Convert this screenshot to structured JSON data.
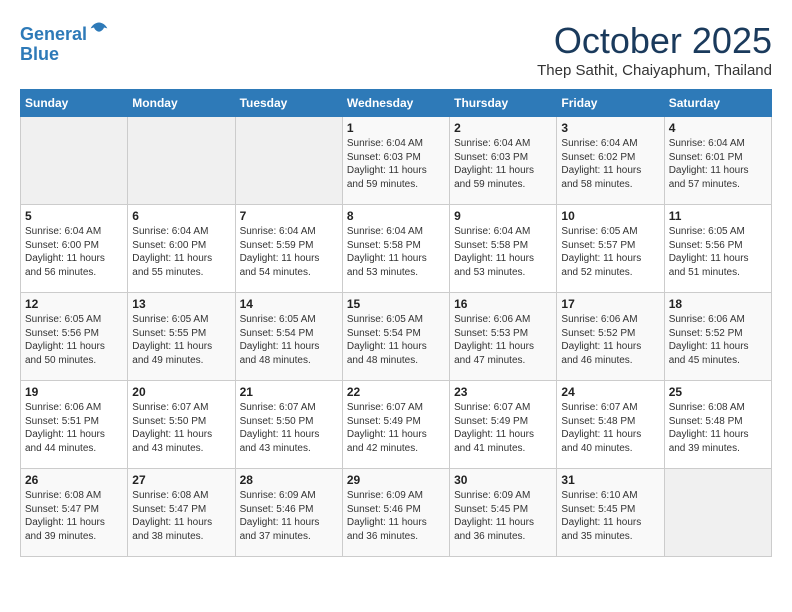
{
  "header": {
    "logo_line1": "General",
    "logo_line2": "Blue",
    "month": "October 2025",
    "location": "Thep Sathit, Chaiyaphum, Thailand"
  },
  "days_of_week": [
    "Sunday",
    "Monday",
    "Tuesday",
    "Wednesday",
    "Thursday",
    "Friday",
    "Saturday"
  ],
  "weeks": [
    [
      {
        "day": "",
        "info": ""
      },
      {
        "day": "",
        "info": ""
      },
      {
        "day": "",
        "info": ""
      },
      {
        "day": "1",
        "info": "Sunrise: 6:04 AM\nSunset: 6:03 PM\nDaylight: 11 hours\nand 59 minutes."
      },
      {
        "day": "2",
        "info": "Sunrise: 6:04 AM\nSunset: 6:03 PM\nDaylight: 11 hours\nand 59 minutes."
      },
      {
        "day": "3",
        "info": "Sunrise: 6:04 AM\nSunset: 6:02 PM\nDaylight: 11 hours\nand 58 minutes."
      },
      {
        "day": "4",
        "info": "Sunrise: 6:04 AM\nSunset: 6:01 PM\nDaylight: 11 hours\nand 57 minutes."
      }
    ],
    [
      {
        "day": "5",
        "info": "Sunrise: 6:04 AM\nSunset: 6:00 PM\nDaylight: 11 hours\nand 56 minutes."
      },
      {
        "day": "6",
        "info": "Sunrise: 6:04 AM\nSunset: 6:00 PM\nDaylight: 11 hours\nand 55 minutes."
      },
      {
        "day": "7",
        "info": "Sunrise: 6:04 AM\nSunset: 5:59 PM\nDaylight: 11 hours\nand 54 minutes."
      },
      {
        "day": "8",
        "info": "Sunrise: 6:04 AM\nSunset: 5:58 PM\nDaylight: 11 hours\nand 53 minutes."
      },
      {
        "day": "9",
        "info": "Sunrise: 6:04 AM\nSunset: 5:58 PM\nDaylight: 11 hours\nand 53 minutes."
      },
      {
        "day": "10",
        "info": "Sunrise: 6:05 AM\nSunset: 5:57 PM\nDaylight: 11 hours\nand 52 minutes."
      },
      {
        "day": "11",
        "info": "Sunrise: 6:05 AM\nSunset: 5:56 PM\nDaylight: 11 hours\nand 51 minutes."
      }
    ],
    [
      {
        "day": "12",
        "info": "Sunrise: 6:05 AM\nSunset: 5:56 PM\nDaylight: 11 hours\nand 50 minutes."
      },
      {
        "day": "13",
        "info": "Sunrise: 6:05 AM\nSunset: 5:55 PM\nDaylight: 11 hours\nand 49 minutes."
      },
      {
        "day": "14",
        "info": "Sunrise: 6:05 AM\nSunset: 5:54 PM\nDaylight: 11 hours\nand 48 minutes."
      },
      {
        "day": "15",
        "info": "Sunrise: 6:05 AM\nSunset: 5:54 PM\nDaylight: 11 hours\nand 48 minutes."
      },
      {
        "day": "16",
        "info": "Sunrise: 6:06 AM\nSunset: 5:53 PM\nDaylight: 11 hours\nand 47 minutes."
      },
      {
        "day": "17",
        "info": "Sunrise: 6:06 AM\nSunset: 5:52 PM\nDaylight: 11 hours\nand 46 minutes."
      },
      {
        "day": "18",
        "info": "Sunrise: 6:06 AM\nSunset: 5:52 PM\nDaylight: 11 hours\nand 45 minutes."
      }
    ],
    [
      {
        "day": "19",
        "info": "Sunrise: 6:06 AM\nSunset: 5:51 PM\nDaylight: 11 hours\nand 44 minutes."
      },
      {
        "day": "20",
        "info": "Sunrise: 6:07 AM\nSunset: 5:50 PM\nDaylight: 11 hours\nand 43 minutes."
      },
      {
        "day": "21",
        "info": "Sunrise: 6:07 AM\nSunset: 5:50 PM\nDaylight: 11 hours\nand 43 minutes."
      },
      {
        "day": "22",
        "info": "Sunrise: 6:07 AM\nSunset: 5:49 PM\nDaylight: 11 hours\nand 42 minutes."
      },
      {
        "day": "23",
        "info": "Sunrise: 6:07 AM\nSunset: 5:49 PM\nDaylight: 11 hours\nand 41 minutes."
      },
      {
        "day": "24",
        "info": "Sunrise: 6:07 AM\nSunset: 5:48 PM\nDaylight: 11 hours\nand 40 minutes."
      },
      {
        "day": "25",
        "info": "Sunrise: 6:08 AM\nSunset: 5:48 PM\nDaylight: 11 hours\nand 39 minutes."
      }
    ],
    [
      {
        "day": "26",
        "info": "Sunrise: 6:08 AM\nSunset: 5:47 PM\nDaylight: 11 hours\nand 39 minutes."
      },
      {
        "day": "27",
        "info": "Sunrise: 6:08 AM\nSunset: 5:47 PM\nDaylight: 11 hours\nand 38 minutes."
      },
      {
        "day": "28",
        "info": "Sunrise: 6:09 AM\nSunset: 5:46 PM\nDaylight: 11 hours\nand 37 minutes."
      },
      {
        "day": "29",
        "info": "Sunrise: 6:09 AM\nSunset: 5:46 PM\nDaylight: 11 hours\nand 36 minutes."
      },
      {
        "day": "30",
        "info": "Sunrise: 6:09 AM\nSunset: 5:45 PM\nDaylight: 11 hours\nand 36 minutes."
      },
      {
        "day": "31",
        "info": "Sunrise: 6:10 AM\nSunset: 5:45 PM\nDaylight: 11 hours\nand 35 minutes."
      },
      {
        "day": "",
        "info": ""
      }
    ]
  ]
}
